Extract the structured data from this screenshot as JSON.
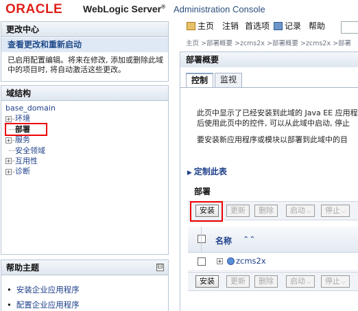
{
  "header": {
    "brand": "ORACLE",
    "product": "WebLogic Server",
    "product_mark": "®",
    "subtitle": "Administration Console"
  },
  "change_center": {
    "title": "更改中心",
    "link": "查看更改和重新启动",
    "text": "已启用配置编辑。将来在修改, 添加或删除此域中的项目时, 将自动激活这些更改。"
  },
  "domain_structure": {
    "title": "域结构",
    "root": "base_domain",
    "items": [
      {
        "label": "环境",
        "expander": "+"
      },
      {
        "label": "部署",
        "expander": ""
      },
      {
        "label": "服务",
        "expander": "+"
      },
      {
        "label": "安全领域",
        "expander": ""
      },
      {
        "label": "互用性",
        "expander": "+"
      },
      {
        "label": "诊断",
        "expander": "+"
      }
    ]
  },
  "help_topics": {
    "title": "帮助主题",
    "toggle": "⊟",
    "items": [
      "安装企业应用程序",
      "配置企业应用程序"
    ]
  },
  "toolbar": {
    "home": "主页",
    "logout": "注销",
    "preferences": "首选项",
    "record": "记录",
    "help": "帮助"
  },
  "breadcrumb": "主页 >部署概要 >zcms2x >部署概要 >zcms2x >部署",
  "main": {
    "title": "部署概要",
    "tabs": [
      "控制",
      "监视"
    ],
    "desc_lines": [
      "此页中显示了已经安装到此域的 Java EE 应用程序",
      "后使用此页中的控件, 可以从此域中启动, 停止",
      "要安装新应用程序或模块以部署到此域中的目"
    ],
    "customize": "定制此表",
    "section": "部署",
    "buttons": [
      {
        "label": "安装",
        "enabled": true
      },
      {
        "label": "更新",
        "enabled": false
      },
      {
        "label": "删除",
        "enabled": false
      },
      {
        "label": "启动",
        "enabled": false,
        "caret": "⌵"
      },
      {
        "label": "停止",
        "enabled": false,
        "caret": "⌵"
      }
    ],
    "column_name": "名称",
    "sort_indicator": "⌃⌃",
    "rows": [
      {
        "name": "zcms2x",
        "expander": "+"
      }
    ]
  },
  "colors": {
    "oracle_red": "#e0201b",
    "link_blue": "#1d3f8a",
    "highlight_red": "#ee0000"
  }
}
